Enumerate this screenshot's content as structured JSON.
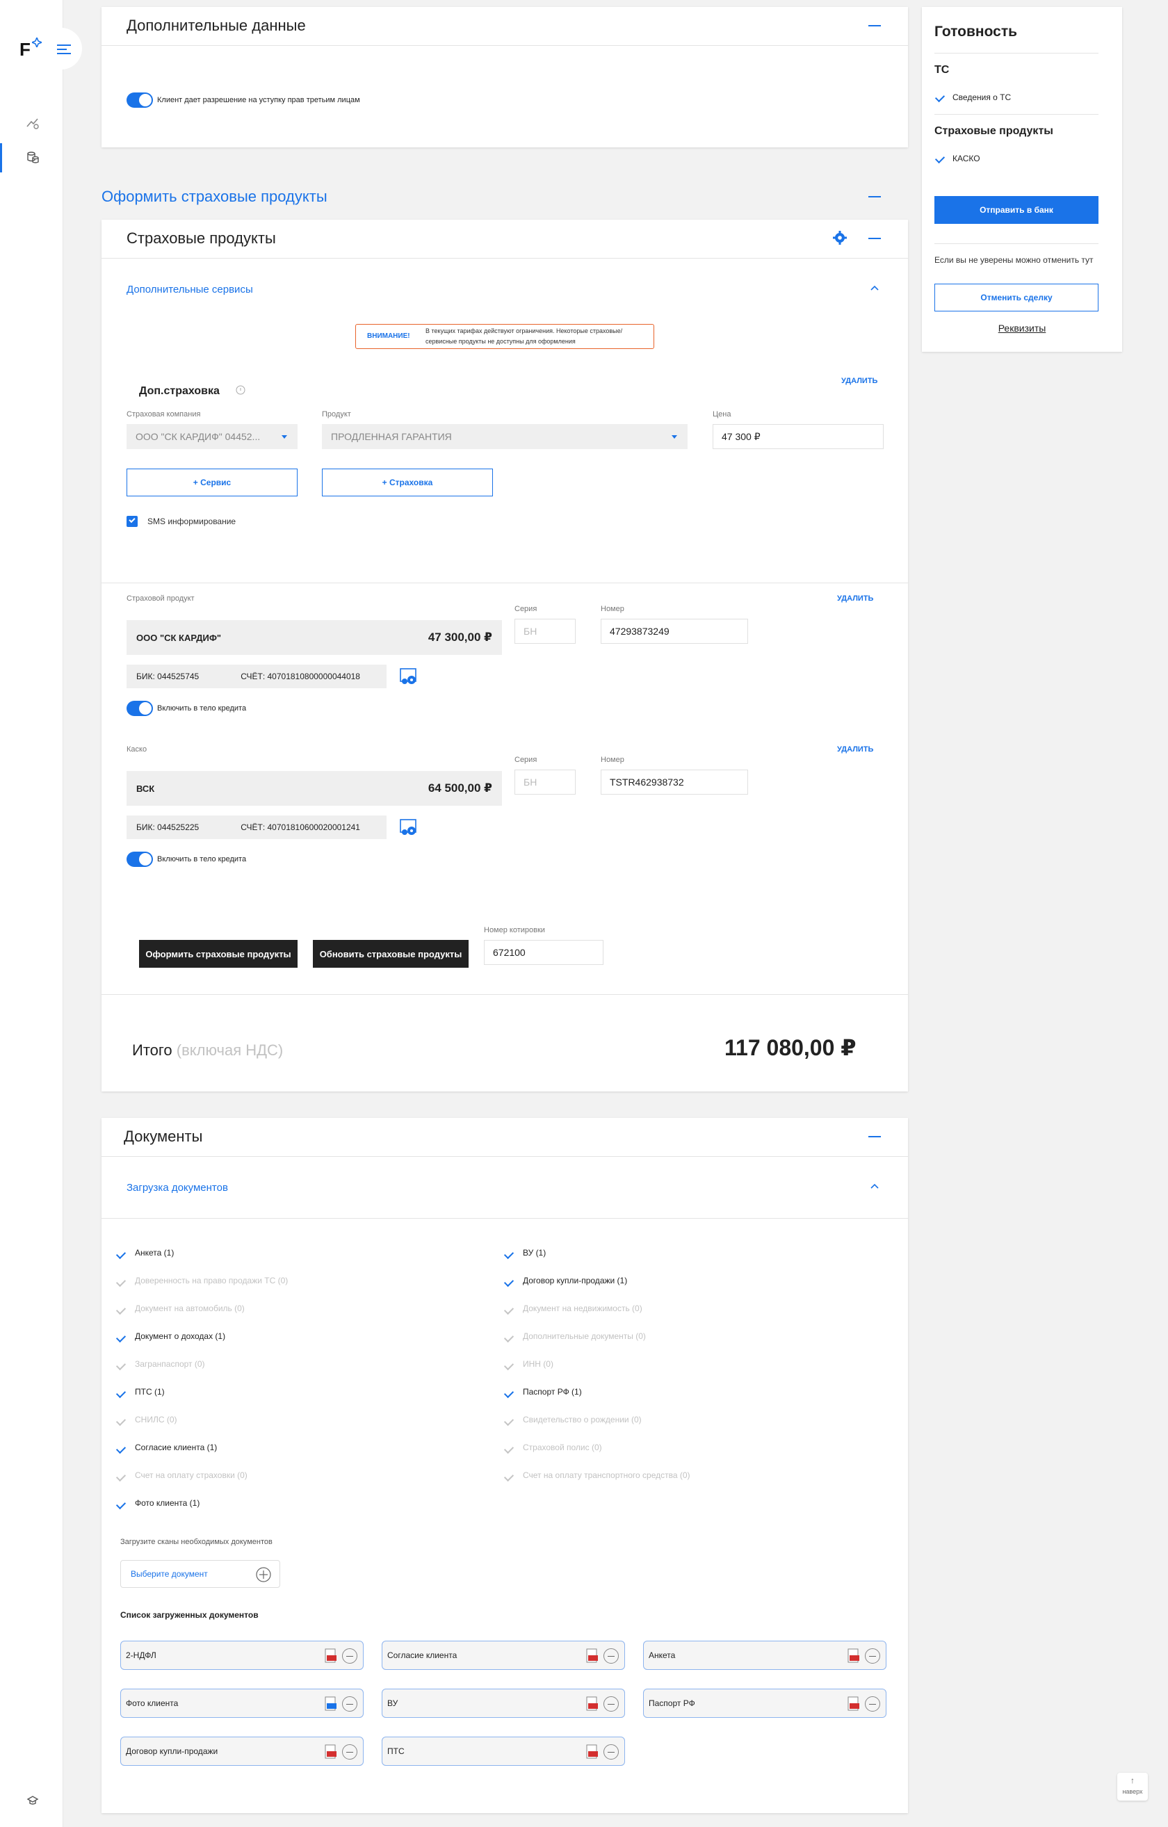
{
  "sidebar": {
    "logo": "F"
  },
  "additional_data": {
    "title": "Дополнительные данные",
    "toggle_label": "Клиент дает разрешение на уступку прав третьим лицам"
  },
  "section_title": "Оформить страховые продукты",
  "insurance": {
    "title": "Страховые продукты",
    "extra_services": "Дополнительные сервисы",
    "warning": {
      "label": "ВНИМАНИЕ!",
      "text_line1": "В текущих тарифах действуют ограничения. Некоторые страховые/",
      "text_line2": "сервисные продукты не доступны для оформления"
    },
    "dop": {
      "title": "Доп.страховка",
      "delete": "УДАЛИТЬ",
      "company_label": "Страховая компания",
      "company_value": "ООО \"СК КАРДИФ\" 04452...",
      "product_label": "Продукт",
      "product_value": "ПРОДЛЕННАЯ ГАРАНТИЯ",
      "price_label": "Цена",
      "price_value": "47 300 ₽",
      "add_service": "+ Сервис",
      "add_insurance": "+ Страховка",
      "sms": "SMS информирование"
    },
    "product1": {
      "label": "Страховой продукт",
      "delete": "УДАЛИТЬ",
      "company": "ООО \"СК КАРДИФ\"",
      "amount": "47 300,00 ₽",
      "series_label": "Серия",
      "series_ph": "БН",
      "number_label": "Номер",
      "number_value": "47293873249",
      "bik": "БИК: 044525745",
      "account": "СЧЁТ: 40701810800000044018",
      "toggle_label": "Включить в тело кредита"
    },
    "product2": {
      "label": "Каско",
      "delete": "УДАЛИТЬ",
      "company": "ВСК",
      "amount": "64 500,00 ₽",
      "series_label": "Серия",
      "series_ph": "БН",
      "number_label": "Номер",
      "number_value": "TSTR462938732",
      "bik": "БИК: 044525225",
      "account": "СЧЁТ: 40701810600020001241",
      "toggle_label": "Включить в тело кредита"
    },
    "btn_issue": "Оформить страховые продукты",
    "btn_update": "Обновить страховые продукты",
    "quote_label": "Номер котировки",
    "quote_value": "672100",
    "total_label": "Итого",
    "total_note": "(включая НДС)",
    "total_value": "117 080,00 ₽"
  },
  "documents": {
    "title": "Документы",
    "upload_title": "Загрузка документов",
    "left": [
      {
        "text": "Анкета (1)",
        "done": true
      },
      {
        "text": "Доверенность на право продажи ТС (0)",
        "done": false
      },
      {
        "text": "Документ на автомобиль (0)",
        "done": false
      },
      {
        "text": "Документ о доходах (1)",
        "done": true
      },
      {
        "text": "Загранпаспорт (0)",
        "done": false
      },
      {
        "text": "ПТС (1)",
        "done": true
      },
      {
        "text": "СНИЛС (0)",
        "done": false
      },
      {
        "text": "Согласие клиента (1)",
        "done": true
      },
      {
        "text": "Счет на оплату страховки (0)",
        "done": false
      },
      {
        "text": "Фото клиента (1)",
        "done": true
      }
    ],
    "right": [
      {
        "text": "ВУ (1)",
        "done": true
      },
      {
        "text": "Договор купли-продажи (1)",
        "done": true
      },
      {
        "text": "Документ на недвижимость (0)",
        "done": false
      },
      {
        "text": "Дополнительные документы (0)",
        "done": false
      },
      {
        "text": "ИНН (0)",
        "done": false
      },
      {
        "text": "Паспорт РФ (1)",
        "done": true
      },
      {
        "text": "Свидетельство о рождении (0)",
        "done": false
      },
      {
        "text": "Страховой полис (0)",
        "done": false
      },
      {
        "text": "Счет на оплату транспортного средства (0)",
        "done": false
      }
    ],
    "upload_hint": "Загрузите сканы необходимых документов",
    "select_placeholder": "Выберите документ",
    "uploaded_title": "Список загруженных документов",
    "uploaded": [
      {
        "name": "2-НДФЛ",
        "type": "pdf"
      },
      {
        "name": "Согласие клиента",
        "type": "pdf"
      },
      {
        "name": "Анкета",
        "type": "pdf"
      },
      {
        "name": "Фото клиента",
        "type": "img"
      },
      {
        "name": "ВУ",
        "type": "pdf"
      },
      {
        "name": "Паспорт РФ",
        "type": "pdf"
      },
      {
        "name": "Договор купли-продажи",
        "type": "pdf"
      },
      {
        "name": "ПТС",
        "type": "pdf"
      }
    ]
  },
  "readiness": {
    "title": "Готовность",
    "ts_title": "ТС",
    "ts_item": "Сведения о ТС",
    "ins_title": "Страховые продукты",
    "ins_item": "КАСКО",
    "send_button": "Отправить в банк",
    "cancel_hint": "Если вы не уверены можно отменить тут",
    "cancel_button": "Отменить сделку",
    "requisites": "Реквизиты"
  },
  "scroll_top": {
    "label": "наверх"
  },
  "colors": {
    "accent": "#1a73e8",
    "dark": "#222222",
    "warning": "#e8632a"
  }
}
